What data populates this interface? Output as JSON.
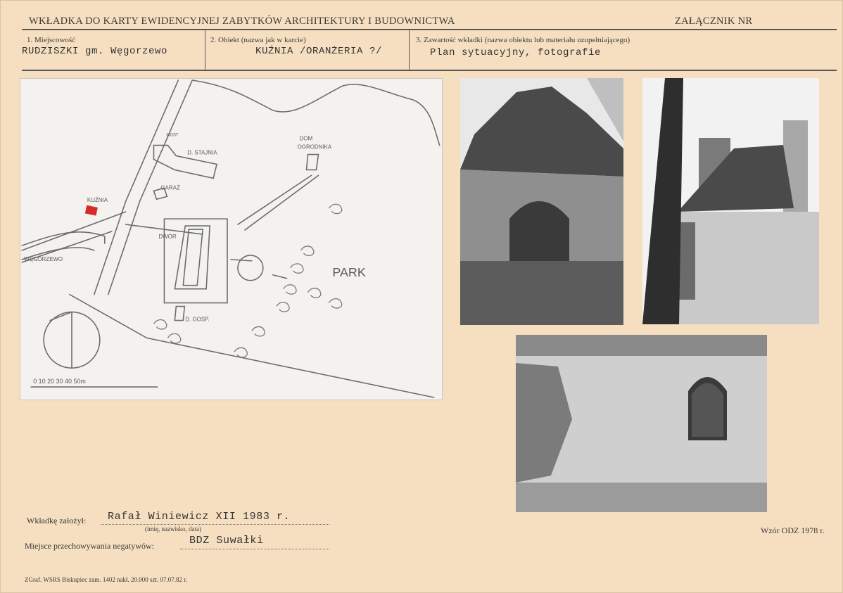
{
  "header": {
    "title": "WKŁADKA DO KARTY EWIDENCYJNEJ ZABYTKÓW ARCHITEKTURY I BUDOWNICTWA",
    "attachment": "ZAŁĄCZNIK NR"
  },
  "fields": {
    "locality_label": "1. Miejscowość",
    "locality_value": "RUDZISZKI gm. Węgorzewo",
    "object_label": "2. Obiekt (nazwa jak w karcie)",
    "object_value": "KUŹNIA /ORANŻERIA ?/",
    "contents_label": "3. Zawartość wkładki (nazwa obiektu lub materiału uzupełniającego)",
    "contents_value": "Plan sytuacyjny, fotografie"
  },
  "map": {
    "labels": {
      "kuznia": "KUŹNIA",
      "stajnia": "D. STAJNIA",
      "most": "MOST",
      "garaz": "GARAŻ",
      "dom_ogrodnika_1": "DOM",
      "dom_ogrodnika_2": "OGRODNIKA",
      "dwor": "DWÓR",
      "park": "PARK",
      "d_gosp": "D. GOSP.",
      "wegorzewo": "WĘGORZEWO",
      "scale": "0 10 20 30 40 50m"
    }
  },
  "footer": {
    "founder_label": "Wkładkę założył:",
    "founder_value": "Rafał Winiewicz   XII 1983 r.",
    "founder_hint": "(imię, nazwisko, data)",
    "storage_label": "Miejsce przechowywania negatywów:",
    "storage_value": "BDZ Suwałki",
    "pattern": "Wzór ODZ 1978 r.",
    "print_info": "ZGraf. WSRS Biskupiec zam. 1402 nakł. 20.000 szt. 07.07.82 r."
  },
  "colors": {
    "paper": "#f5dfc0",
    "ink": "#3b3a3a",
    "marker": "#d62b2b"
  }
}
